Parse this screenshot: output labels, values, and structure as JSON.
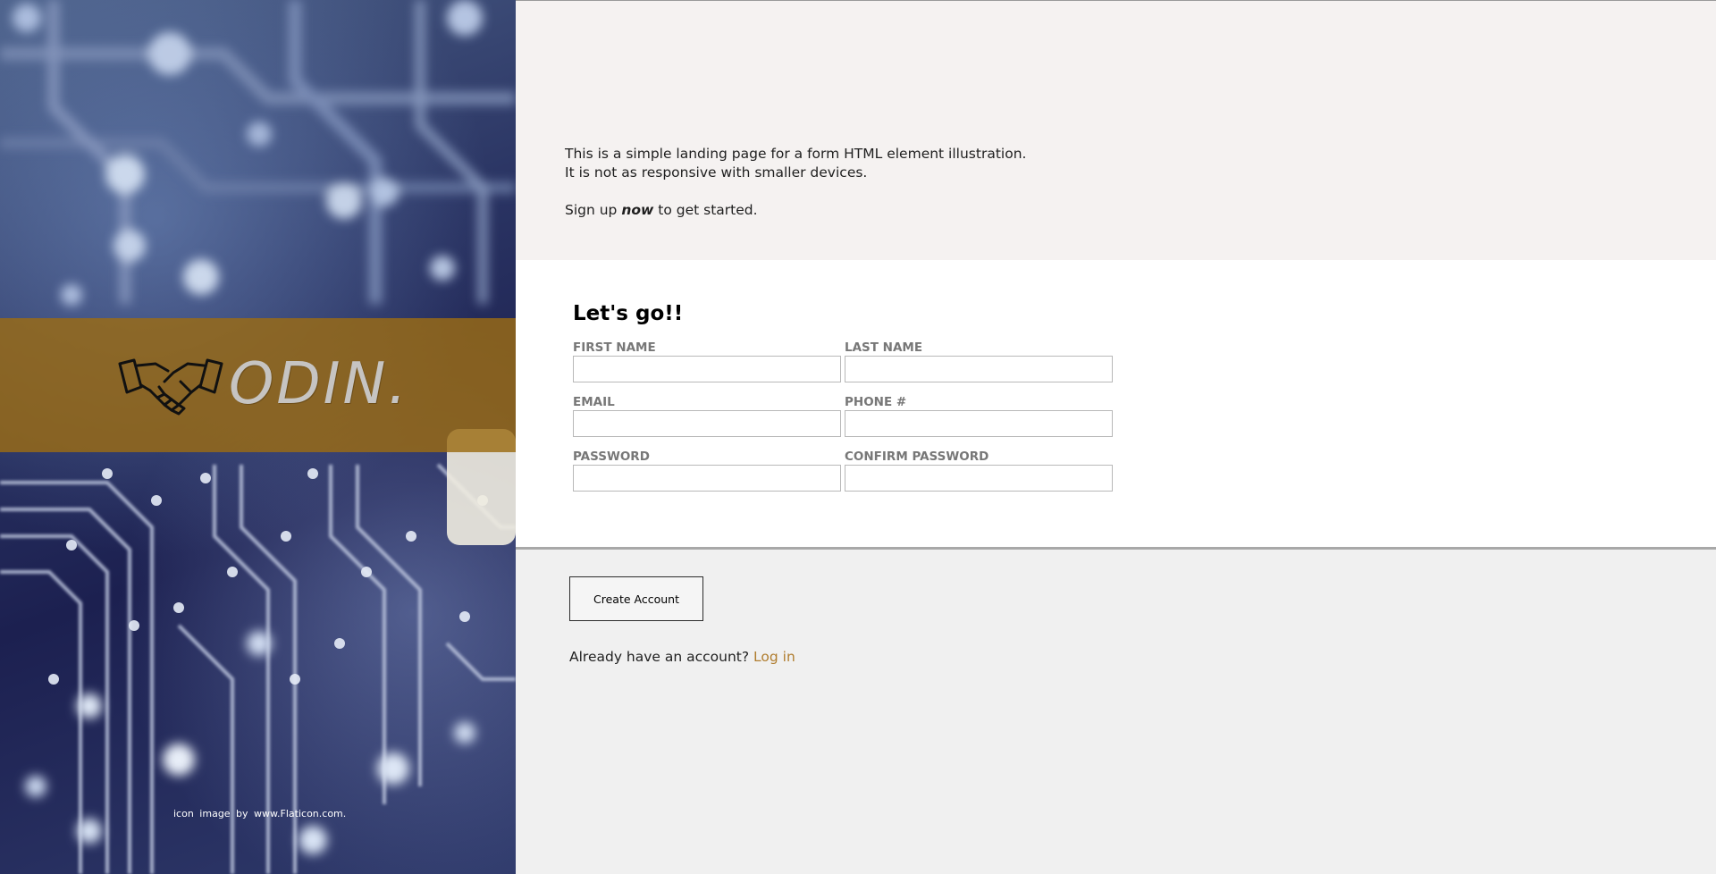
{
  "hero": {
    "logo_icon": "handshake-icon",
    "logo_text": "ODIN.",
    "credit": "icon image by www.Flaticon.com.",
    "banner_color": "#9b6b14"
  },
  "intro": {
    "line1": "This is a simple landing page for a form HTML element illustration.",
    "line2": "It is not as responsive with smaller devices.",
    "line3_before": "Sign up ",
    "line3_emphasis": "now",
    "line3_after": " to get started."
  },
  "form": {
    "title": "Let's go!!",
    "fields": {
      "first_name": {
        "label": "FIRST NAME",
        "value": ""
      },
      "last_name": {
        "label": "LAST NAME",
        "value": ""
      },
      "email": {
        "label": "EMAIL",
        "value": ""
      },
      "phone": {
        "label": "PHONE #",
        "value": ""
      },
      "password": {
        "label": "PASSWORD",
        "value": ""
      },
      "confirm_password": {
        "label": "CONFIRM PASSWORD",
        "value": ""
      }
    }
  },
  "actions": {
    "create_label": "Create Account",
    "login_prompt": "Already have an account? ",
    "login_link": "Log in",
    "link_color": "#b07d2f"
  }
}
